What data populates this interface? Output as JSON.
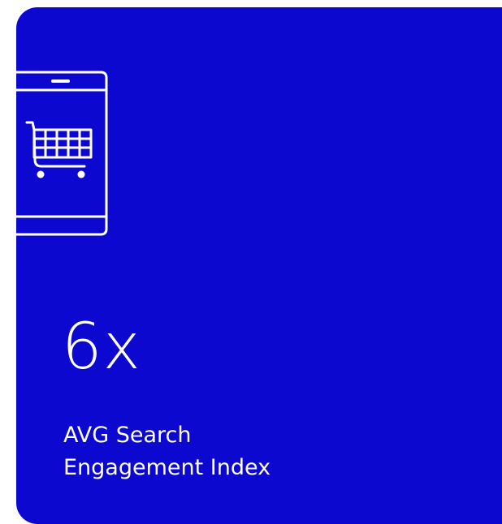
{
  "card": {
    "background_color": "#0c08cf",
    "icon": "mobile-shopping-cart-icon",
    "value": "6x",
    "label_line1": "AVG Search",
    "label_line2": "Engagement Index"
  }
}
